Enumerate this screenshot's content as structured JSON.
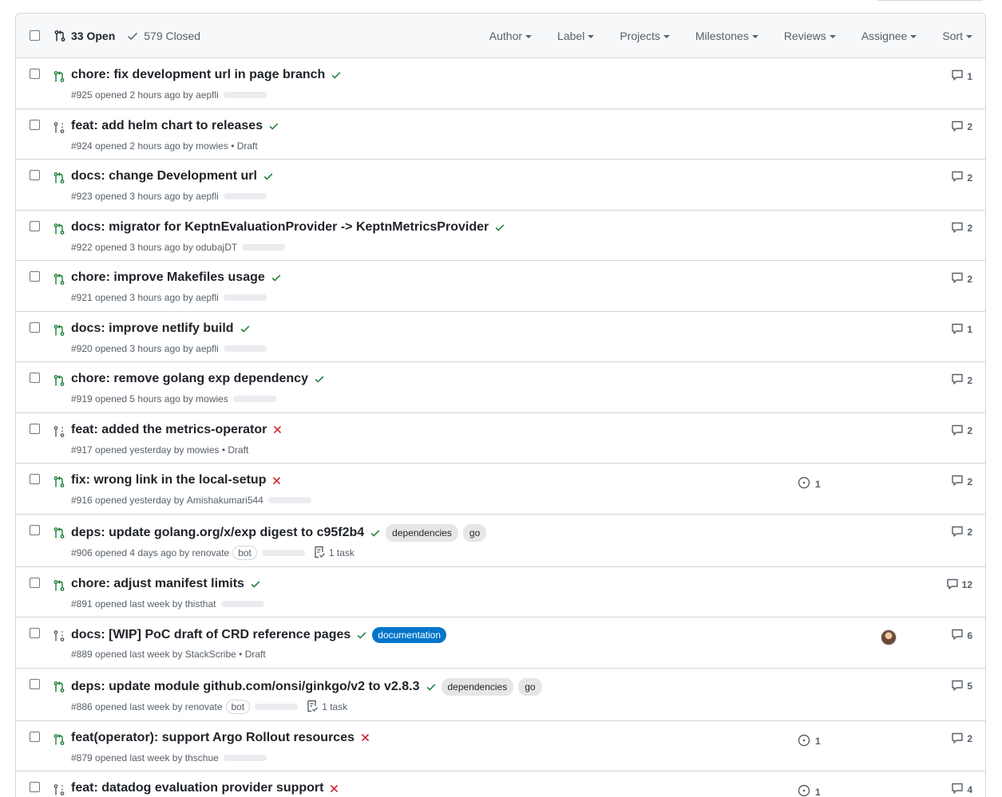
{
  "header": {
    "open_label": "33 Open",
    "closed_label": "579 Closed",
    "filters": [
      "Author",
      "Label",
      "Projects",
      "Milestones",
      "Reviews",
      "Assignee",
      "Sort"
    ]
  },
  "colors": {
    "check": "#1a7f37",
    "fail": "#cf222e",
    "open_pr": "#1a7f37",
    "draft_pr": "#57606a",
    "label_blue": "#0075ca"
  },
  "rows": [
    {
      "title": "chore: fix development url in page branch",
      "status": "success",
      "draft": false,
      "number": "#925",
      "opened": "opened 2 hours ago by",
      "author": "aepfli",
      "suffix": "",
      "bot": "",
      "task": "",
      "labels": [],
      "issues": "",
      "avatar": false,
      "comments": "1"
    },
    {
      "title": "feat: add helm chart to releases",
      "status": "success",
      "draft": true,
      "number": "#924",
      "opened": "opened 2 hours ago by",
      "author": "mowies",
      "suffix": "• Draft",
      "bot": "",
      "task": "",
      "labels": [],
      "issues": "",
      "avatar": false,
      "comments": "2"
    },
    {
      "title": "docs: change Development url",
      "status": "success",
      "draft": false,
      "number": "#923",
      "opened": "opened 3 hours ago by",
      "author": "aepfli",
      "suffix": "",
      "bot": "",
      "task": "",
      "labels": [],
      "issues": "",
      "avatar": false,
      "comments": "2"
    },
    {
      "title": "docs: migrator for KeptnEvaluationProvider -> KeptnMetricsProvider",
      "status": "success",
      "draft": false,
      "number": "#922",
      "opened": "opened 3 hours ago by",
      "author": "odubajDT",
      "suffix": "",
      "bot": "",
      "task": "",
      "labels": [],
      "issues": "",
      "avatar": false,
      "comments": "2"
    },
    {
      "title": "chore: improve Makefiles usage",
      "status": "success",
      "draft": false,
      "number": "#921",
      "opened": "opened 3 hours ago by",
      "author": "aepfli",
      "suffix": "",
      "bot": "",
      "task": "",
      "labels": [],
      "issues": "",
      "avatar": false,
      "comments": "2"
    },
    {
      "title": "docs: improve netlify build",
      "status": "success",
      "draft": false,
      "number": "#920",
      "opened": "opened 3 hours ago by",
      "author": "aepfli",
      "suffix": "",
      "bot": "",
      "task": "",
      "labels": [],
      "issues": "",
      "avatar": false,
      "comments": "1"
    },
    {
      "title": "chore: remove golang exp dependency",
      "status": "success",
      "draft": false,
      "number": "#919",
      "opened": "opened 5 hours ago by",
      "author": "mowies",
      "suffix": "",
      "bot": "",
      "task": "",
      "labels": [],
      "issues": "",
      "avatar": false,
      "comments": "2"
    },
    {
      "title": "feat: added the metrics-operator",
      "status": "failure",
      "draft": true,
      "number": "#917",
      "opened": "opened yesterday by",
      "author": "mowies",
      "suffix": "• Draft",
      "bot": "",
      "task": "",
      "labels": [],
      "issues": "",
      "avatar": false,
      "comments": "2"
    },
    {
      "title": "fix: wrong link in the local-setup",
      "status": "failure",
      "draft": false,
      "number": "#916",
      "opened": "opened yesterday by",
      "author": "Amishakumari544",
      "suffix": "",
      "bot": "",
      "task": "",
      "labels": [],
      "issues": "1",
      "avatar": false,
      "comments": "2"
    },
    {
      "title": "deps: update golang.org/x/exp digest to c95f2b4",
      "status": "success",
      "draft": false,
      "number": "#906",
      "opened": "opened 4 days ago by",
      "author": "renovate",
      "suffix": "",
      "bot": "bot",
      "task": "1 task",
      "labels": [
        {
          "name": "dependencies",
          "style": "gray"
        },
        {
          "name": "go",
          "style": "gray"
        }
      ],
      "issues": "",
      "avatar": false,
      "comments": "2"
    },
    {
      "title": "chore: adjust manifest limits",
      "status": "success",
      "draft": false,
      "number": "#891",
      "opened": "opened last week by",
      "author": "thisthat",
      "suffix": "",
      "bot": "",
      "task": "",
      "labels": [],
      "issues": "",
      "avatar": false,
      "comments": "12"
    },
    {
      "title": "docs: [WIP] PoC draft of CRD reference pages",
      "status": "success",
      "draft": true,
      "number": "#889",
      "opened": "opened last week by",
      "author": "StackScribe",
      "suffix": "• Draft",
      "bot": "",
      "task": "",
      "labels": [
        {
          "name": "documentation",
          "style": "blue"
        }
      ],
      "issues": "",
      "avatar": true,
      "comments": "6"
    },
    {
      "title": "deps: update module github.com/onsi/ginkgo/v2 to v2.8.3",
      "status": "success",
      "draft": false,
      "number": "#886",
      "opened": "opened last week by",
      "author": "renovate",
      "suffix": "",
      "bot": "bot",
      "task": "1 task",
      "labels": [
        {
          "name": "dependencies",
          "style": "gray"
        },
        {
          "name": "go",
          "style": "gray"
        }
      ],
      "issues": "",
      "avatar": false,
      "comments": "5"
    },
    {
      "title": "feat(operator): support Argo Rollout resources",
      "status": "failure",
      "draft": false,
      "number": "#879",
      "opened": "opened last week by",
      "author": "thschue",
      "suffix": "",
      "bot": "",
      "task": "",
      "labels": [],
      "issues": "1",
      "avatar": false,
      "comments": "2"
    },
    {
      "title": "feat: datadog evaluation provider support",
      "status": "failure",
      "draft": true,
      "number": "",
      "opened": "",
      "author": "",
      "suffix": "",
      "bot": "",
      "task": "",
      "labels": [],
      "issues": "1",
      "avatar": false,
      "comments": "4"
    }
  ]
}
